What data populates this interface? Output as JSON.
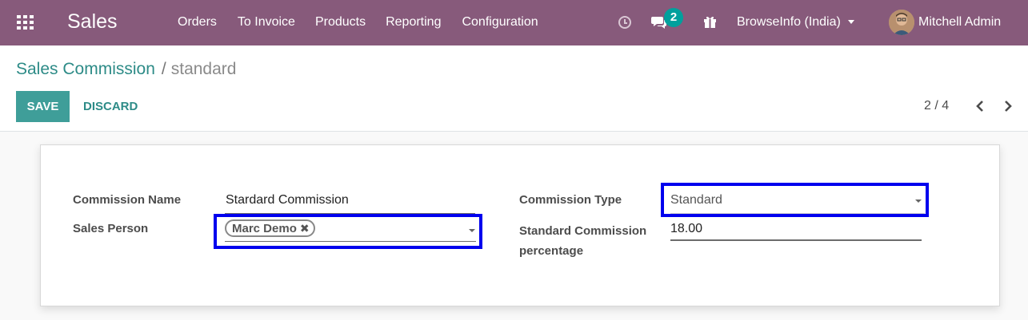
{
  "navbar": {
    "app_name": "Sales",
    "menu": [
      "Orders",
      "To Invoice",
      "Products",
      "Reporting",
      "Configuration"
    ],
    "messages_badge": "2",
    "company": "BrowseInfo (India)",
    "user": "Mitchell Admin",
    "icons": [
      "apps-grid-icon",
      "clock-icon",
      "chat-icon",
      "gift-icon"
    ],
    "color": "#875a7b"
  },
  "breadcrumb": {
    "parent": "Sales Commission",
    "separator": "/",
    "current": "standard"
  },
  "actions": {
    "save": "SAVE",
    "discard": "DISCARD"
  },
  "pager": {
    "value": "2 / 4"
  },
  "form": {
    "commission_name_label": "Commission Name",
    "commission_name_value": "Stardard Commission",
    "sales_person_label": "Sales Person",
    "sales_person_tag": "Marc Demo",
    "commission_type_label": "Commission Type",
    "commission_type_value": "Standard",
    "standard_pct_label_line1": "Standard Commission",
    "standard_pct_label_line2": "percentage",
    "standard_pct_value": "18.00"
  },
  "colors": {
    "accent": "#3f9e99",
    "link": "#2d8b87",
    "highlight": "#0000ee"
  }
}
